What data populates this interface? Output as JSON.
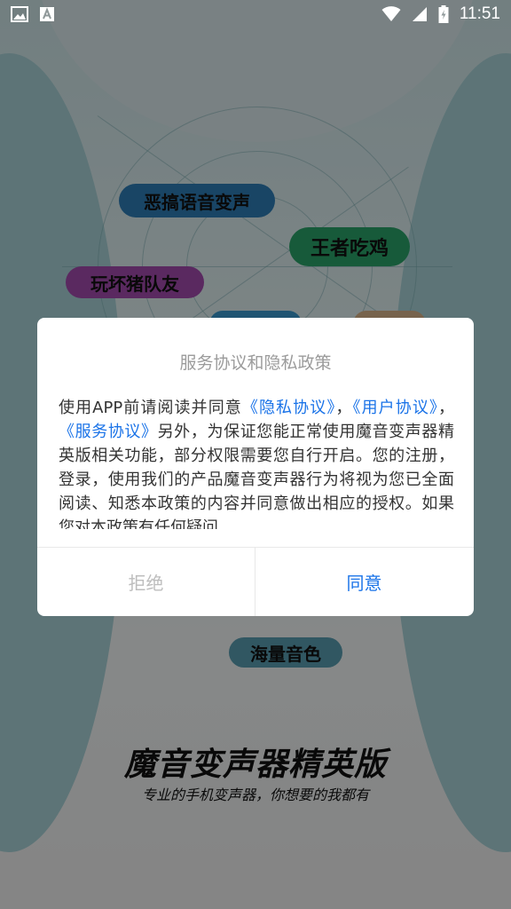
{
  "status_bar": {
    "time": "11:51",
    "icons": [
      "image-notification-icon",
      "text-a-notification-icon",
      "wifi-icon",
      "cellular-signal-icon",
      "battery-charging-icon"
    ]
  },
  "background": {
    "tags": [
      {
        "label": "恶搞语音变声",
        "color": "#2f7fb8"
      },
      {
        "label": "王者吃鸡",
        "color": "#2aa56a"
      },
      {
        "label": "玩坏猪队友",
        "color": "#a44bb0"
      },
      {
        "label": "海量音色",
        "color": "#5a9fb2"
      }
    ],
    "title": "魔音变声器精英版",
    "subtitle": "专业的手机变声器，你想要的我都有"
  },
  "dialog": {
    "title": "服务协议和隐私政策",
    "body": {
      "t1": "使用APP前请阅读并同意",
      "link_privacy": "《隐私协议》",
      "t2": "，",
      "link_user": "《用户协议》",
      "t3": "，",
      "link_service": "《服务协议》",
      "t4": "另外，为保证您能正常使用魔音变声器精英版相关功能，部分权限需要您自行开启。您的注册，登录，使用我们的产品魔音变声器行为将视为您已全面阅读、知悉本政策的内容并同意做出相应的授权。如果您对本政策有任何疑问、"
    },
    "reject_label": "拒绝",
    "agree_label": "同意"
  },
  "colors": {
    "link": "#1a73e8",
    "agree": "#1a73e8",
    "reject": "#bdbdbd"
  }
}
